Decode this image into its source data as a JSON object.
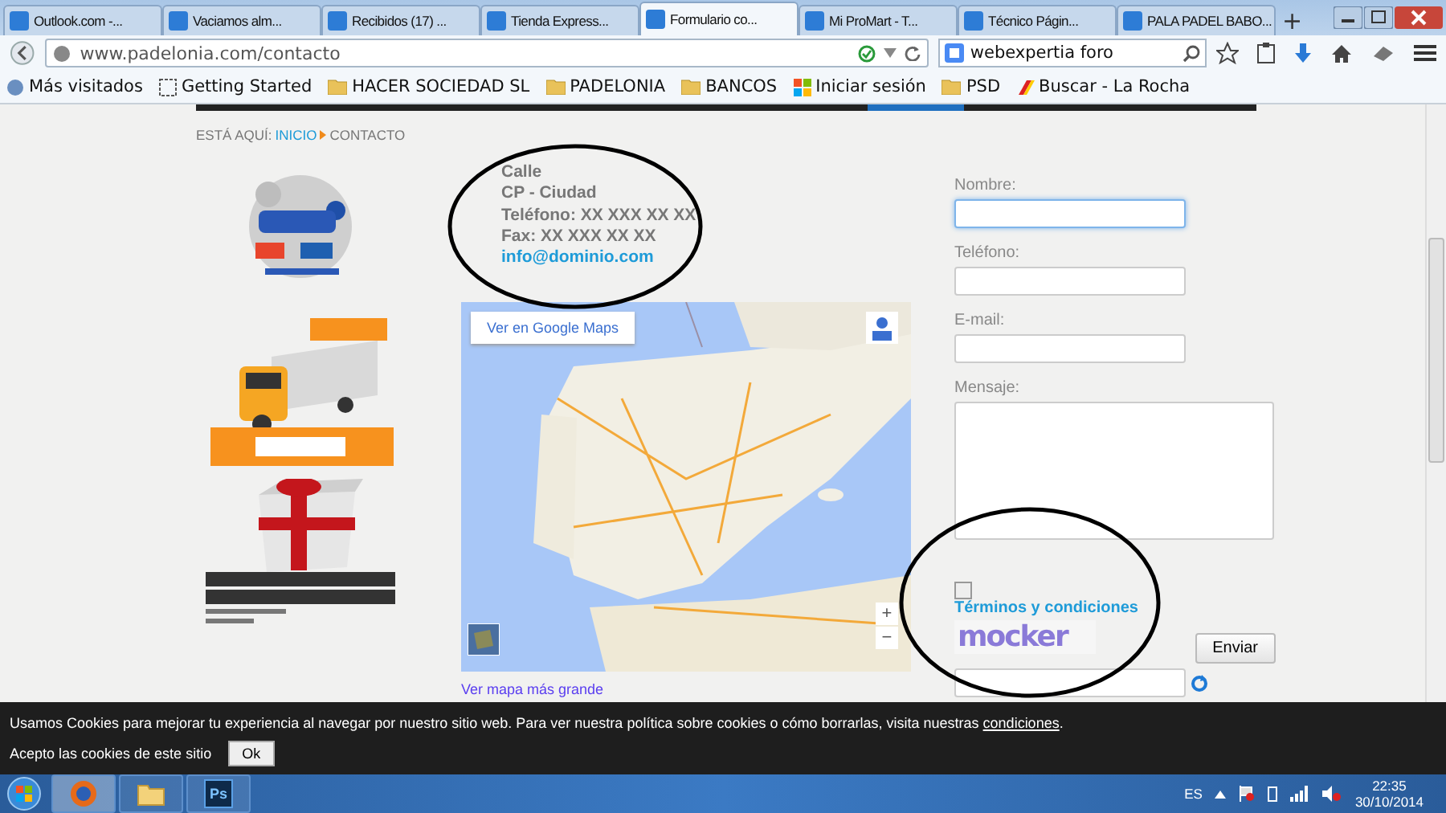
{
  "browser": {
    "tabs": [
      {
        "title": "Outlook.com -...",
        "selected": false
      },
      {
        "title": "Vaciamos alm...",
        "selected": false
      },
      {
        "title": "Recibidos (17) ...",
        "selected": false
      },
      {
        "title": "Tienda Express...",
        "selected": false
      },
      {
        "title": "Formulario co...",
        "selected": true
      },
      {
        "title": "Mi ProMart - T...",
        "selected": false
      },
      {
        "title": "Técnico Págin...",
        "selected": false
      },
      {
        "title": "PALA PADEL BABO...",
        "selected": false
      }
    ],
    "new_tab": "+",
    "url": "www.padelonia.com/contacto",
    "search": {
      "value": "webexpertia foro"
    },
    "bookmarks": [
      "Más visitados",
      "Getting Started",
      "HACER SOCIEDAD SL",
      "PADELONIA",
      "BANCOS",
      "Iniciar sesión",
      "PSD",
      "Buscar - La Rocha"
    ]
  },
  "page": {
    "breadcrumb": {
      "prefix": "ESTÁ AQUÍ:",
      "home": "INICIO",
      "current": "CONTACTO"
    },
    "contact": {
      "lines": [
        "Calle",
        "CP - Ciudad",
        "Teléfono: XX XXX XX XX",
        "Fax: XX XXX XX XX"
      ],
      "email": "info@dominio.com"
    },
    "map": {
      "kind": "picture",
      "open_button": "Ver en Google Maps",
      "zoom_in": "+",
      "zoom_out": "−",
      "larger_link": "Ver mapa más grande"
    },
    "form": {
      "fields": [
        {
          "label": "Nombre:",
          "kind": "input",
          "focused": true
        },
        {
          "label": "Teléfono:",
          "kind": "input",
          "focused": false
        },
        {
          "label": "E-mail:",
          "kind": "input",
          "focused": false
        },
        {
          "label": "Mensaje:",
          "kind": "textarea",
          "focused": false
        }
      ],
      "terms": {
        "checked": false,
        "link": "Términos y condiciones"
      },
      "captcha": "mocker",
      "submit": "Enviar"
    }
  },
  "cookie_bar": {
    "text": "Usamos Cookies para mejorar tu experiencia al navegar por nuestro sitio web. Para ver nuestra política sobre cookies o cómo borrarlas, visita nuestras ",
    "link": "condiciones",
    "end": ".",
    "accept_label": "Acepto las cookies de este sitio",
    "ok": "Ok"
  },
  "taskbar": {
    "apps": [
      {
        "kind": "firefox",
        "active": true
      },
      {
        "kind": "explorer",
        "active": false
      },
      {
        "kind": "photoshop",
        "label": "Ps",
        "active": false
      }
    ],
    "language": "ES",
    "time": "22:35",
    "date": "30/10/2014"
  }
}
